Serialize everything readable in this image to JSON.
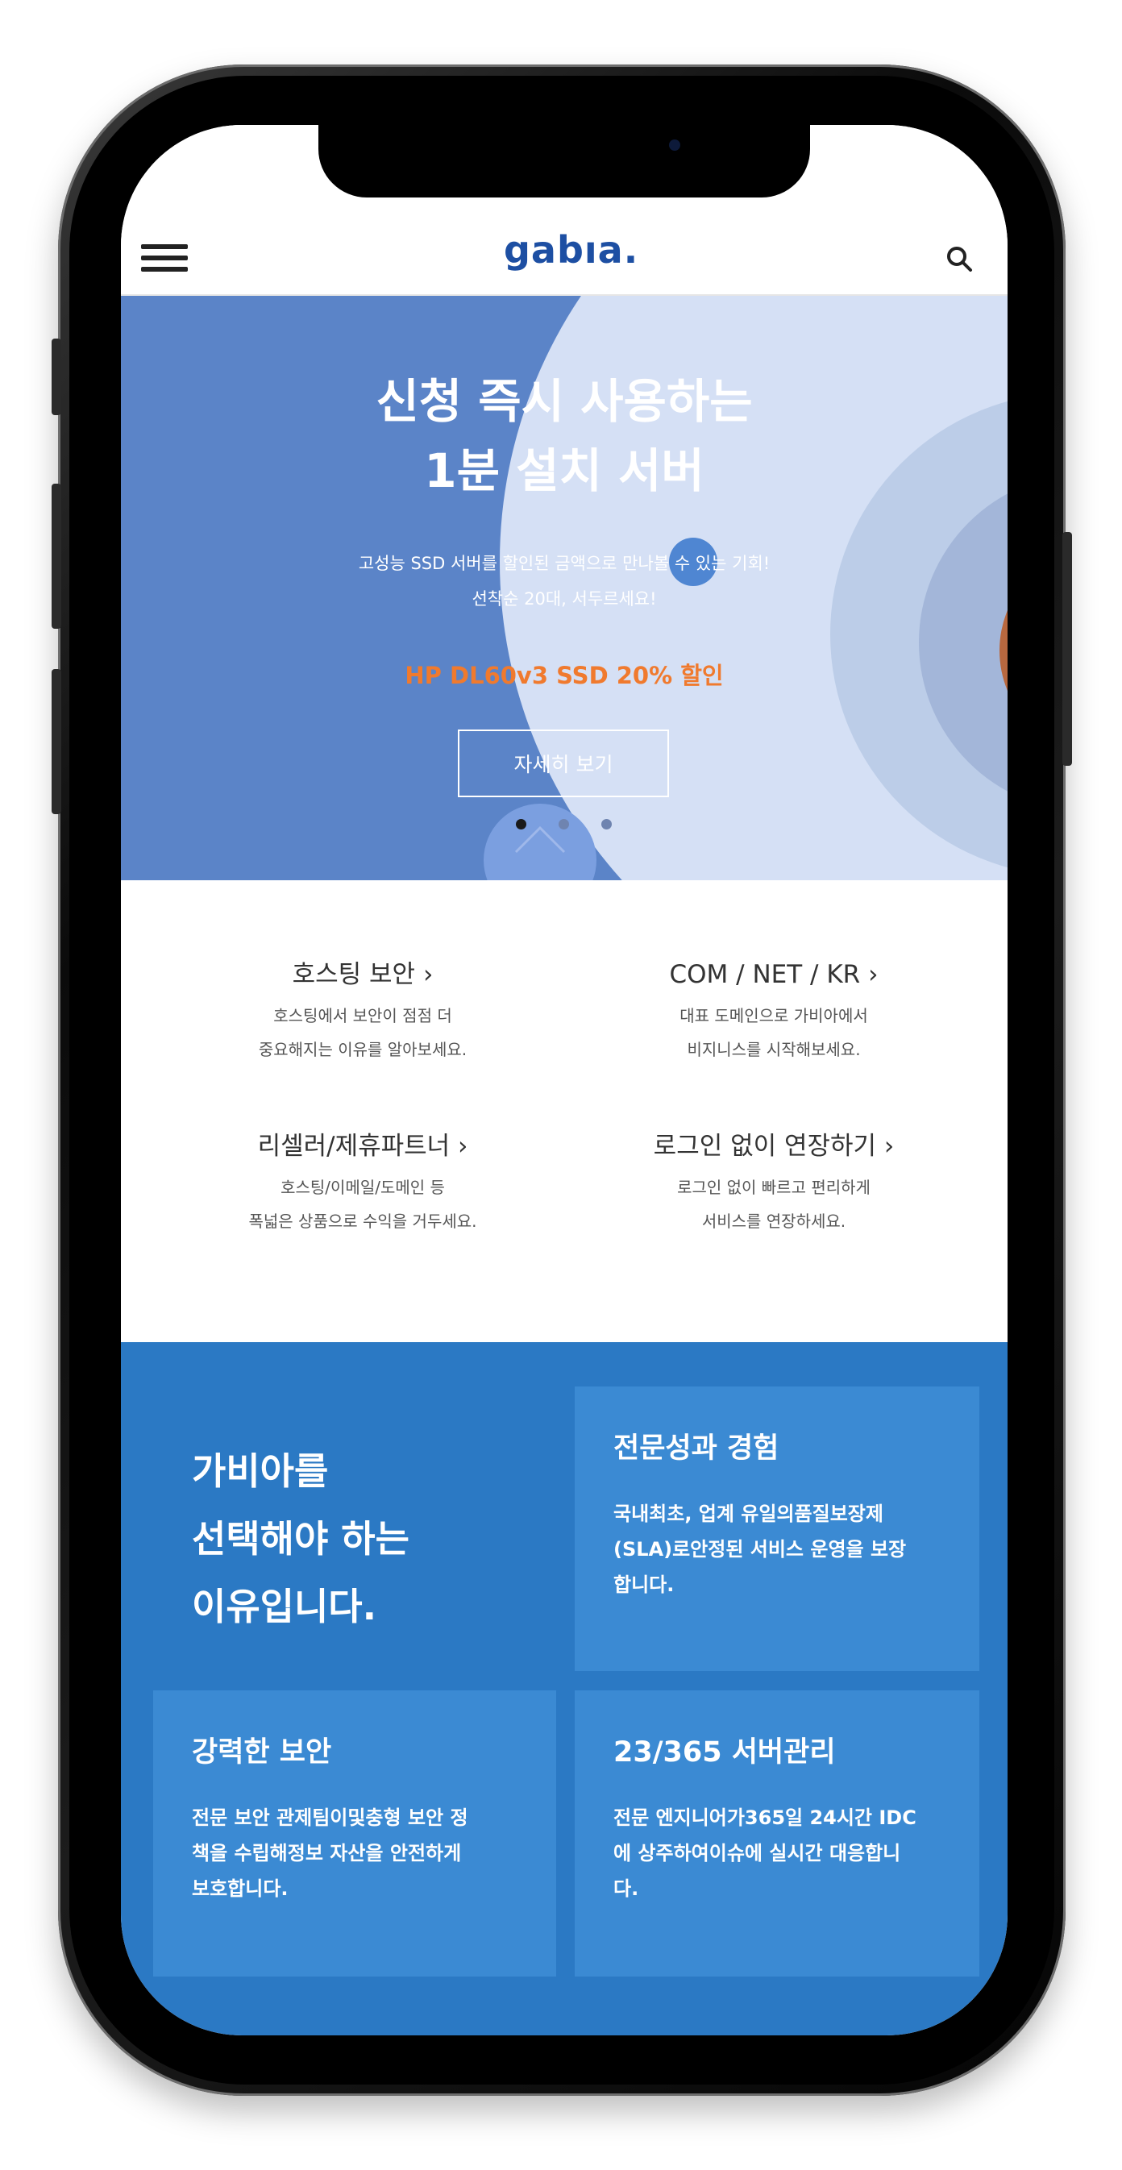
{
  "header": {
    "logo_text": "gabıa.",
    "menu_icon": "hamburger-menu-icon",
    "search_icon": "search-icon"
  },
  "hero": {
    "title_line1": "신청 즉시 사용하는",
    "title_line2": "1분 설치 서버",
    "subtitle_line1": "고성능 SSD 서버를 할인된 금액으로 만나볼 수 있는 기회!",
    "subtitle_line2": "선착순 20대, 서두르세요!",
    "promo": "HP DL60v3 SSD 20% 할인",
    "button_label": "자세히 보기",
    "slides": 3,
    "active_slide": 1,
    "promo_color": "#f07a2e",
    "bg_color": "#5b84c8"
  },
  "quick_links": [
    {
      "title": "호스팅 보안",
      "desc_line1": "호스팅에서 보안이 점점 더",
      "desc_line2": "중요해지는 이유를 알아보세요."
    },
    {
      "title": "COM / NET / KR",
      "desc_line1": "대표 도메인으로 가비아에서",
      "desc_line2": "비지니스를 시작해보세요."
    },
    {
      "title": "리셀러/제휴파트너",
      "desc_line1": "호스팅/이메일/도메인 등",
      "desc_line2": "폭넓은 상품으로 수익을 거두세요."
    },
    {
      "title": "로그인 없이 연장하기",
      "desc_line1": "로그인 없이 빠르고 편리하게",
      "desc_line2": "서비스를 연장하세요."
    }
  ],
  "quick_link_arrow": "›",
  "why": {
    "heading_line1": "가비아를",
    "heading_line2": "선택해야 하는",
    "heading_line3": "이유입니다.",
    "bg_color": "#2b79c4",
    "card_color": "#3b8ad3",
    "cards": [
      {
        "title": "전문성과 경험",
        "text_line1": "국내최초, 업계 유일의품질보장제",
        "text_line2": "(SLA)로안정된 서비스 운영을 보장",
        "text_line3": "합니다."
      },
      {
        "title": "강력한 보안",
        "text_line1": "전문 보안 관제팀이및충형 보안 정",
        "text_line2": "책을 수립해정보 자산을 안전하게",
        "text_line3": "보호합니다."
      },
      {
        "title": "23/365 서버관리",
        "text_line1": "전문 엔지니어가365일 24시간 IDC",
        "text_line2": "에 상주하여이슈에 실시간 대응합니",
        "text_line3": "다."
      }
    ]
  }
}
